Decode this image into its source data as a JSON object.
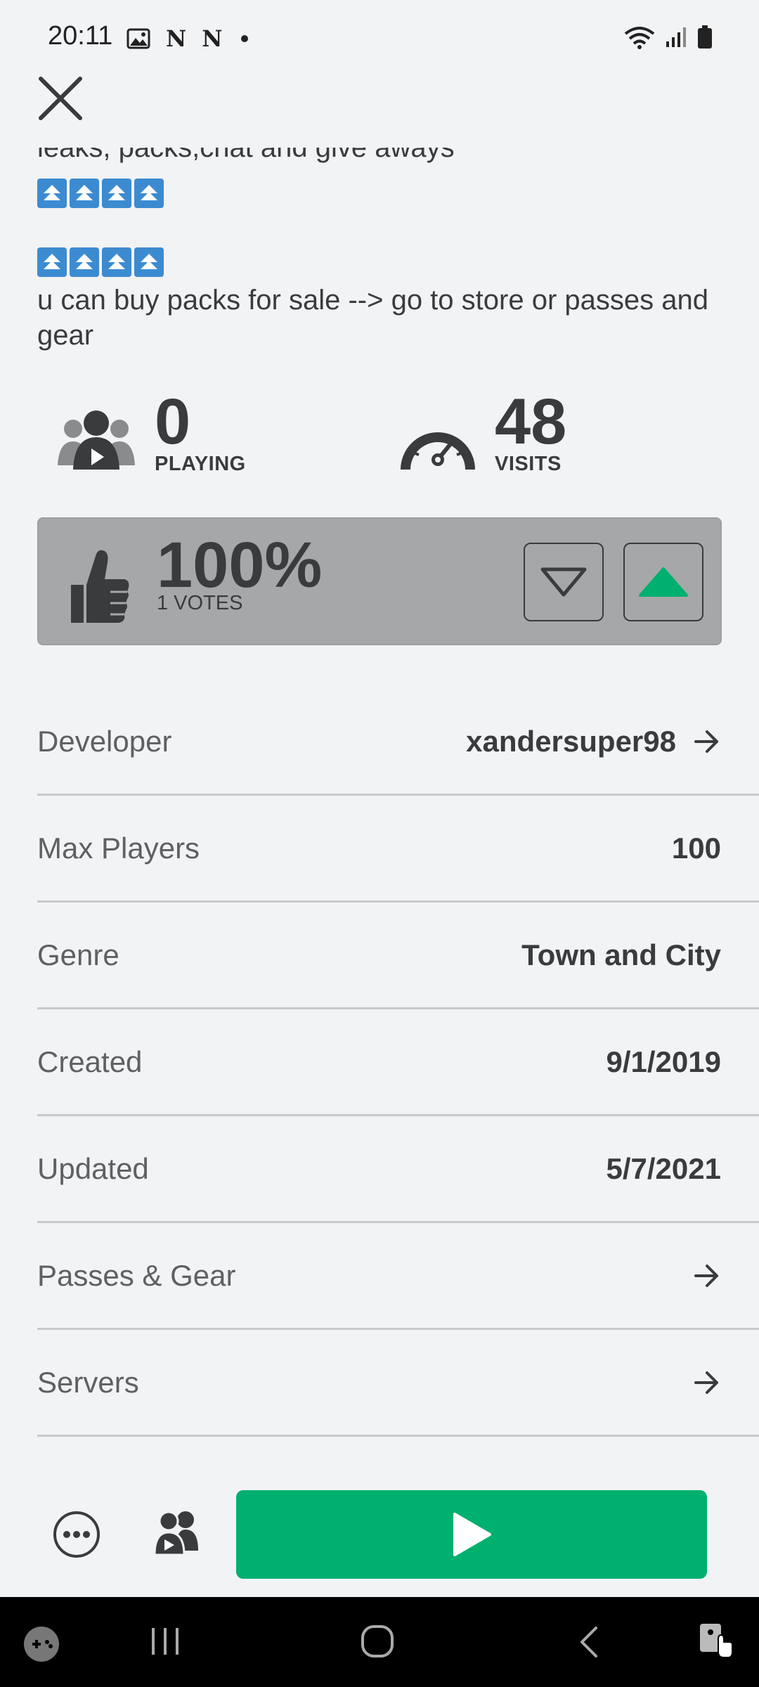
{
  "status_bar": {
    "time": "20:11",
    "left_icons": [
      "image-icon",
      "netflix-n-icon",
      "netflix-n-icon",
      "dot-icon"
    ],
    "right_icons": [
      "wifi-icon",
      "signal-icon",
      "battery-icon"
    ]
  },
  "description": {
    "cut_line": "leaks, packs,chat and give aways",
    "text": "u can buy packs for sale --> go to store or passes and gear"
  },
  "stats": {
    "playing_value": "0",
    "playing_label": "PLAYING",
    "visits_value": "48",
    "visits_label": "VISITS"
  },
  "rating": {
    "percent": "100%",
    "votes": "1 VOTES"
  },
  "info": {
    "developer_label": "Developer",
    "developer_value": "xandersuper98",
    "max_players_label": "Max Players",
    "max_players_value": "100",
    "genre_label": "Genre",
    "genre_value": "Town and City",
    "created_label": "Created",
    "created_value": "9/1/2019",
    "updated_label": "Updated",
    "updated_value": "5/7/2021",
    "passes_label": "Passes & Gear",
    "servers_label": "Servers"
  },
  "colors": {
    "play_green": "#00b06f",
    "badge_blue": "#3c8bd1",
    "vote_panel": "#a6a7a9",
    "background": "#f2f3f5"
  }
}
